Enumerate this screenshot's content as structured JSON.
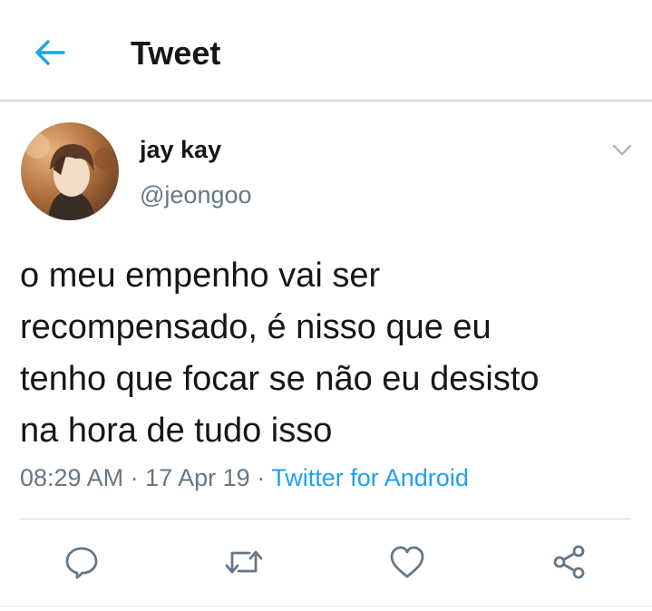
{
  "header": {
    "title": "Tweet",
    "back_icon": "back-arrow-icon"
  },
  "tweet": {
    "author": {
      "display_name": "jay kay",
      "handle": "@jeongoo"
    },
    "text_lines": [
      "o meu empenho vai ser",
      "recompensado, é nisso que eu",
      "tenho que focar se não eu desisto",
      "na hora de tudo isso"
    ],
    "time": "08:29 AM",
    "date": "17 Apr 19",
    "source": "Twitter for Android",
    "separator": "·"
  },
  "actions": {
    "icons": [
      "reply-icon",
      "retweet-icon",
      "like-icon",
      "share-icon"
    ]
  },
  "colors": {
    "accent": "#1da1f2",
    "secondary_text": "#657786",
    "primary_text": "#14171a"
  }
}
